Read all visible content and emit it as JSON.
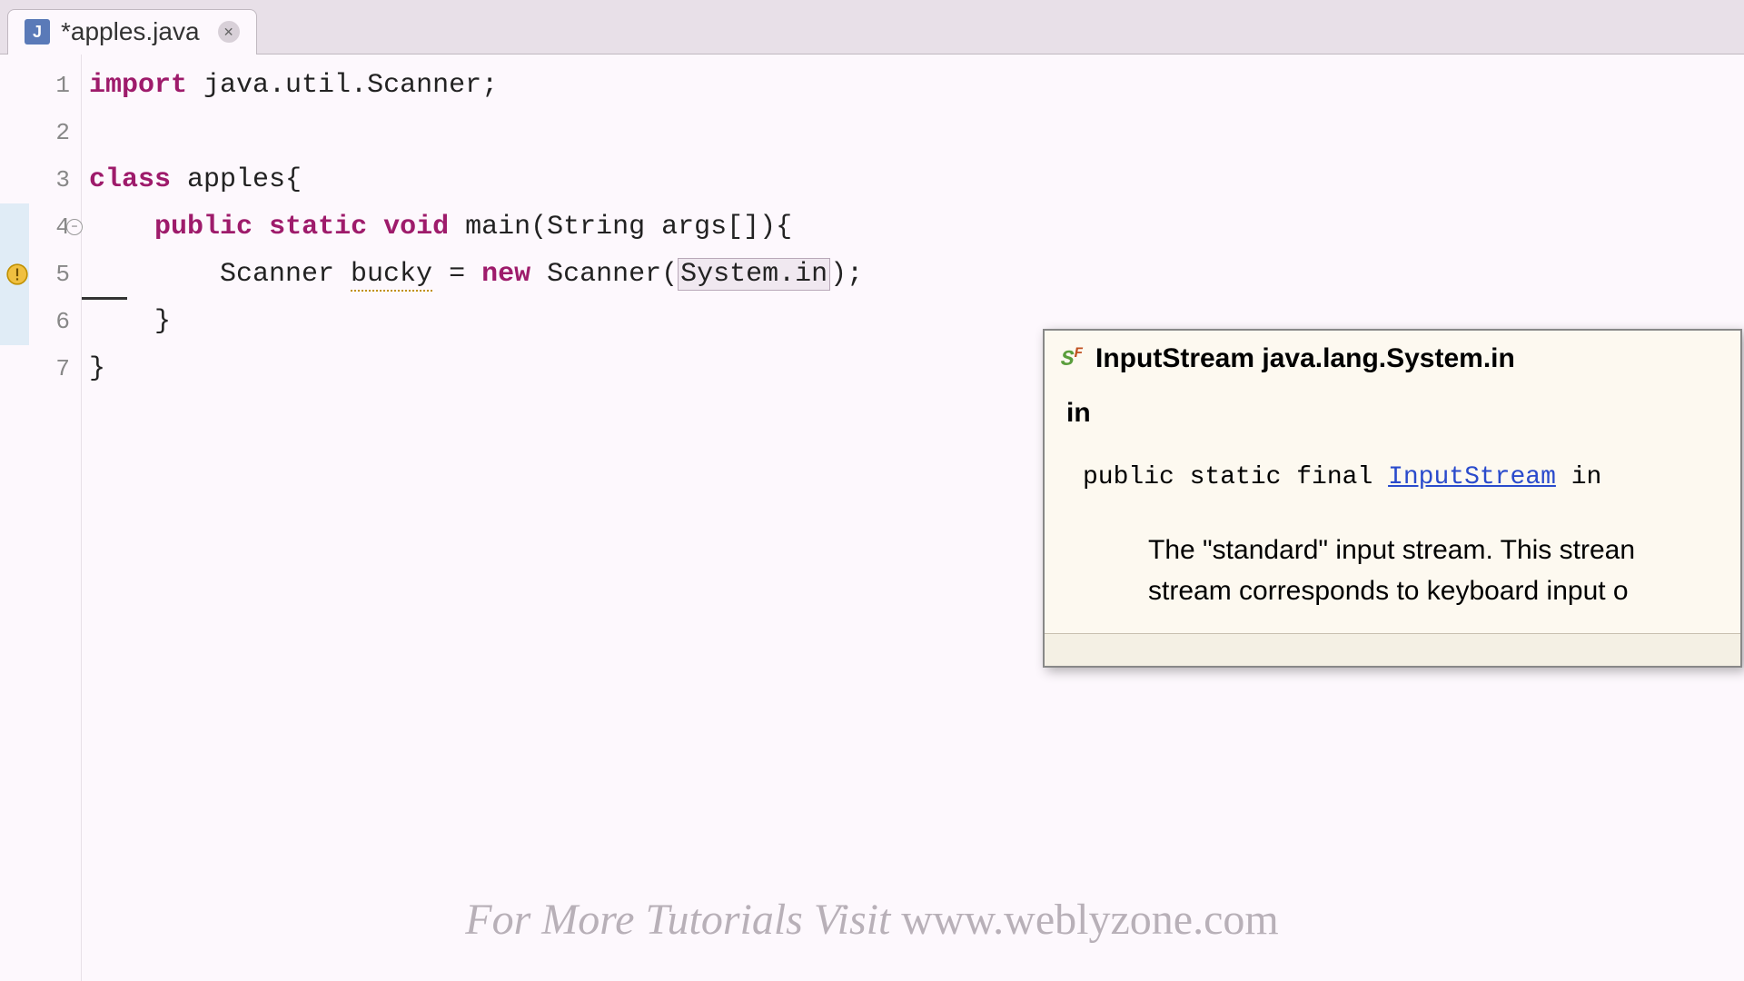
{
  "tab": {
    "icon_letter": "J",
    "label": "*apples.java"
  },
  "gutter": {
    "lines": [
      "1",
      "2",
      "3",
      "4",
      "5",
      "6",
      "7"
    ],
    "fold_line_index": 3,
    "warning_line_index": 4,
    "active_range_start": 3,
    "cursor_line_index": 4
  },
  "code": {
    "line1_kw": "import",
    "line1_rest": " java.util.Scanner;",
    "line3_kw": "class",
    "line3_rest": " apples{",
    "line4_indent": "    ",
    "line4_kw1": "public",
    "line4_sp1": " ",
    "line4_kw2": "static",
    "line4_sp2": " ",
    "line4_kw3": "void",
    "line4_rest": " main(String args[]){",
    "line5_indent": "        Scanner ",
    "line5_var": "bucky",
    "line5_mid": " = ",
    "line5_kw": "new",
    "line5_after": " Scanner(",
    "line5_arg": "System.in",
    "line5_end": ");",
    "line6": "    }",
    "line7": "}"
  },
  "javadoc": {
    "icon_text": "S",
    "icon_sup": "F",
    "title": "InputStream java.lang.System.in",
    "field_name": "in",
    "sig_pre": "public static final ",
    "sig_link": "InputStream",
    "sig_post": " in",
    "description": "The \"standard\" input stream. This strean stream corresponds to keyboard input o"
  },
  "watermark": {
    "text_pre": "For More Tutorials Visit  ",
    "text_url": "www.weblyzone.com"
  }
}
